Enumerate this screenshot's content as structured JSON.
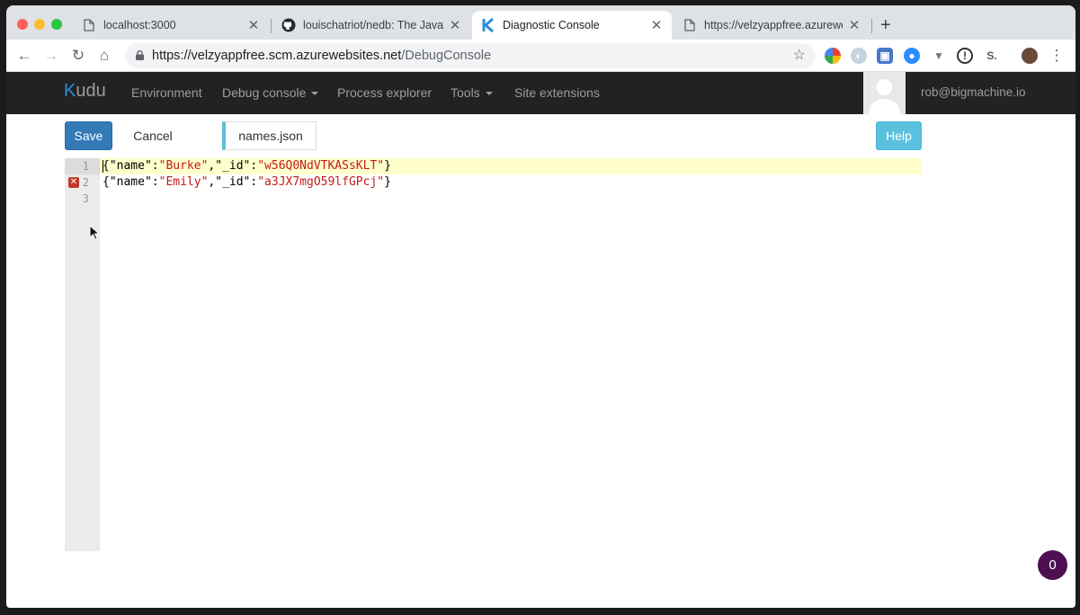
{
  "browser": {
    "tabs": [
      {
        "title": "localhost:3000",
        "icon": "page-icon"
      },
      {
        "title": "louischatriot/nedb: The JavaSc",
        "icon": "github-icon"
      },
      {
        "title": "Diagnostic Console",
        "icon": "kudu-icon",
        "active": true
      },
      {
        "title": "https://velzyappfree.azureweb",
        "icon": "page-icon"
      }
    ],
    "address": {
      "host": "https://velzyappfree.scm.azurewebsites.net",
      "path": "/DebugConsole"
    },
    "extension_labels": [
      "S."
    ]
  },
  "kudu": {
    "brand_k": "K",
    "brand_rest": "udu",
    "nav": [
      "Environment",
      "Debug console",
      "Process explorer",
      "Tools",
      "Site extensions"
    ],
    "user_email": "rob@bigmachine.io"
  },
  "toolbar": {
    "save_label": "Save",
    "cancel_label": "Cancel",
    "filename": "names.json",
    "help_label": "Help"
  },
  "editor": {
    "line_numbers": [
      "1",
      "2",
      "3"
    ],
    "lines": [
      {
        "p1": "{\"name\":",
        "s1": "\"Burke\"",
        "p2": ",\"_id\":",
        "s2": "\"w56Q0NdVTKASsKLT\"",
        "p3": "}"
      },
      {
        "p1": "{\"name\":",
        "s1": "\"Emily\"",
        "p2": ",\"_id\":",
        "s2": "\"a3JX7mgO59lfGPcj\"",
        "p3": "}"
      }
    ],
    "error_line": 2,
    "active_line": 1
  },
  "notification_count": "0",
  "colors": {
    "save": "#337ab7",
    "help": "#5bc0de",
    "navbar": "#222222",
    "string": "#c41a16",
    "badge": "#4e0e52"
  }
}
